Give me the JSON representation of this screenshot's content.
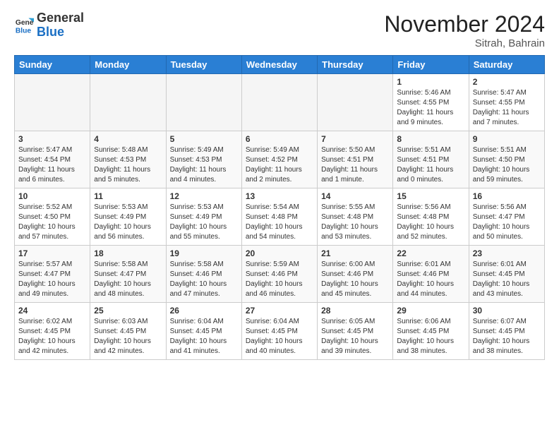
{
  "header": {
    "logo_general": "General",
    "logo_blue": "Blue",
    "month_title": "November 2024",
    "location": "Sitrah, Bahrain"
  },
  "weekdays": [
    "Sunday",
    "Monday",
    "Tuesday",
    "Wednesday",
    "Thursday",
    "Friday",
    "Saturday"
  ],
  "weeks": [
    [
      {
        "day": "",
        "info": ""
      },
      {
        "day": "",
        "info": ""
      },
      {
        "day": "",
        "info": ""
      },
      {
        "day": "",
        "info": ""
      },
      {
        "day": "",
        "info": ""
      },
      {
        "day": "1",
        "info": "Sunrise: 5:46 AM\nSunset: 4:55 PM\nDaylight: 11 hours\nand 9 minutes."
      },
      {
        "day": "2",
        "info": "Sunrise: 5:47 AM\nSunset: 4:55 PM\nDaylight: 11 hours\nand 7 minutes."
      }
    ],
    [
      {
        "day": "3",
        "info": "Sunrise: 5:47 AM\nSunset: 4:54 PM\nDaylight: 11 hours\nand 6 minutes."
      },
      {
        "day": "4",
        "info": "Sunrise: 5:48 AM\nSunset: 4:53 PM\nDaylight: 11 hours\nand 5 minutes."
      },
      {
        "day": "5",
        "info": "Sunrise: 5:49 AM\nSunset: 4:53 PM\nDaylight: 11 hours\nand 4 minutes."
      },
      {
        "day": "6",
        "info": "Sunrise: 5:49 AM\nSunset: 4:52 PM\nDaylight: 11 hours\nand 2 minutes."
      },
      {
        "day": "7",
        "info": "Sunrise: 5:50 AM\nSunset: 4:51 PM\nDaylight: 11 hours\nand 1 minute."
      },
      {
        "day": "8",
        "info": "Sunrise: 5:51 AM\nSunset: 4:51 PM\nDaylight: 11 hours\nand 0 minutes."
      },
      {
        "day": "9",
        "info": "Sunrise: 5:51 AM\nSunset: 4:50 PM\nDaylight: 10 hours\nand 59 minutes."
      }
    ],
    [
      {
        "day": "10",
        "info": "Sunrise: 5:52 AM\nSunset: 4:50 PM\nDaylight: 10 hours\nand 57 minutes."
      },
      {
        "day": "11",
        "info": "Sunrise: 5:53 AM\nSunset: 4:49 PM\nDaylight: 10 hours\nand 56 minutes."
      },
      {
        "day": "12",
        "info": "Sunrise: 5:53 AM\nSunset: 4:49 PM\nDaylight: 10 hours\nand 55 minutes."
      },
      {
        "day": "13",
        "info": "Sunrise: 5:54 AM\nSunset: 4:48 PM\nDaylight: 10 hours\nand 54 minutes."
      },
      {
        "day": "14",
        "info": "Sunrise: 5:55 AM\nSunset: 4:48 PM\nDaylight: 10 hours\nand 53 minutes."
      },
      {
        "day": "15",
        "info": "Sunrise: 5:56 AM\nSunset: 4:48 PM\nDaylight: 10 hours\nand 52 minutes."
      },
      {
        "day": "16",
        "info": "Sunrise: 5:56 AM\nSunset: 4:47 PM\nDaylight: 10 hours\nand 50 minutes."
      }
    ],
    [
      {
        "day": "17",
        "info": "Sunrise: 5:57 AM\nSunset: 4:47 PM\nDaylight: 10 hours\nand 49 minutes."
      },
      {
        "day": "18",
        "info": "Sunrise: 5:58 AM\nSunset: 4:47 PM\nDaylight: 10 hours\nand 48 minutes."
      },
      {
        "day": "19",
        "info": "Sunrise: 5:58 AM\nSunset: 4:46 PM\nDaylight: 10 hours\nand 47 minutes."
      },
      {
        "day": "20",
        "info": "Sunrise: 5:59 AM\nSunset: 4:46 PM\nDaylight: 10 hours\nand 46 minutes."
      },
      {
        "day": "21",
        "info": "Sunrise: 6:00 AM\nSunset: 4:46 PM\nDaylight: 10 hours\nand 45 minutes."
      },
      {
        "day": "22",
        "info": "Sunrise: 6:01 AM\nSunset: 4:46 PM\nDaylight: 10 hours\nand 44 minutes."
      },
      {
        "day": "23",
        "info": "Sunrise: 6:01 AM\nSunset: 4:45 PM\nDaylight: 10 hours\nand 43 minutes."
      }
    ],
    [
      {
        "day": "24",
        "info": "Sunrise: 6:02 AM\nSunset: 4:45 PM\nDaylight: 10 hours\nand 42 minutes."
      },
      {
        "day": "25",
        "info": "Sunrise: 6:03 AM\nSunset: 4:45 PM\nDaylight: 10 hours\nand 42 minutes."
      },
      {
        "day": "26",
        "info": "Sunrise: 6:04 AM\nSunset: 4:45 PM\nDaylight: 10 hours\nand 41 minutes."
      },
      {
        "day": "27",
        "info": "Sunrise: 6:04 AM\nSunset: 4:45 PM\nDaylight: 10 hours\nand 40 minutes."
      },
      {
        "day": "28",
        "info": "Sunrise: 6:05 AM\nSunset: 4:45 PM\nDaylight: 10 hours\nand 39 minutes."
      },
      {
        "day": "29",
        "info": "Sunrise: 6:06 AM\nSunset: 4:45 PM\nDaylight: 10 hours\nand 38 minutes."
      },
      {
        "day": "30",
        "info": "Sunrise: 6:07 AM\nSunset: 4:45 PM\nDaylight: 10 hours\nand 38 minutes."
      }
    ]
  ]
}
